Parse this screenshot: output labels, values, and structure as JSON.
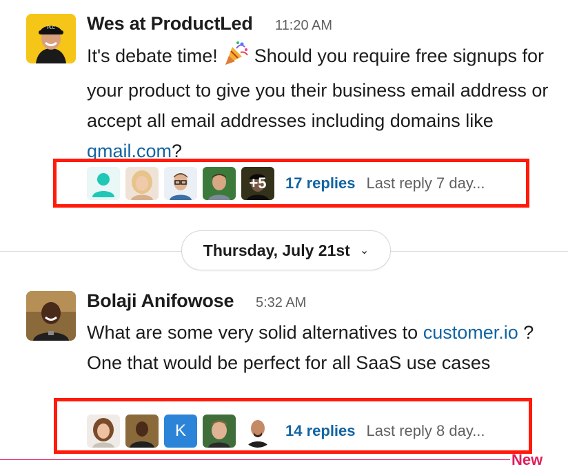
{
  "messages": [
    {
      "sender": "Wes at ProductLed",
      "time": "11:20 AM",
      "text_before": "It's debate time! ",
      "emoji": "party-popper",
      "text_middle": " Should you require free signups for your product to give you their business email address or accept all email addresses including domains like ",
      "link_text": "gmail.com",
      "text_after": "?",
      "thread": {
        "replies": "17 replies",
        "last_reply": "Last reply 7 day...",
        "more_count": "+5",
        "participants": [
          "default-user-avatar",
          "participant-avatar-blonde",
          "participant-avatar-glasses",
          "participant-avatar-green",
          "participant-avatar-cap"
        ]
      }
    },
    {
      "sender": "Bolaji Anifowose",
      "time": "5:32 AM",
      "text_before": "What are some very solid alternatives to ",
      "link_text": "customer.io",
      "text_after": " ? One that would be perfect for all SaaS use cases",
      "thread": {
        "replies": "14 replies",
        "last_reply": "Last reply 8 day...",
        "initial": "K",
        "participants": [
          "participant-avatar-woman",
          "participant-avatar-bolaji",
          "initial-avatar-k",
          "participant-avatar-man-green",
          "participant-avatar-bald"
        ]
      }
    }
  ],
  "date_divider": {
    "label": "Thursday, July 21st"
  },
  "new_marker": {
    "label": "New"
  },
  "colors": {
    "link": "#1264a3",
    "highlight": "#ff1a0a",
    "new": "#e01e5a",
    "text": "#1d1c1d",
    "muted": "#616061"
  }
}
